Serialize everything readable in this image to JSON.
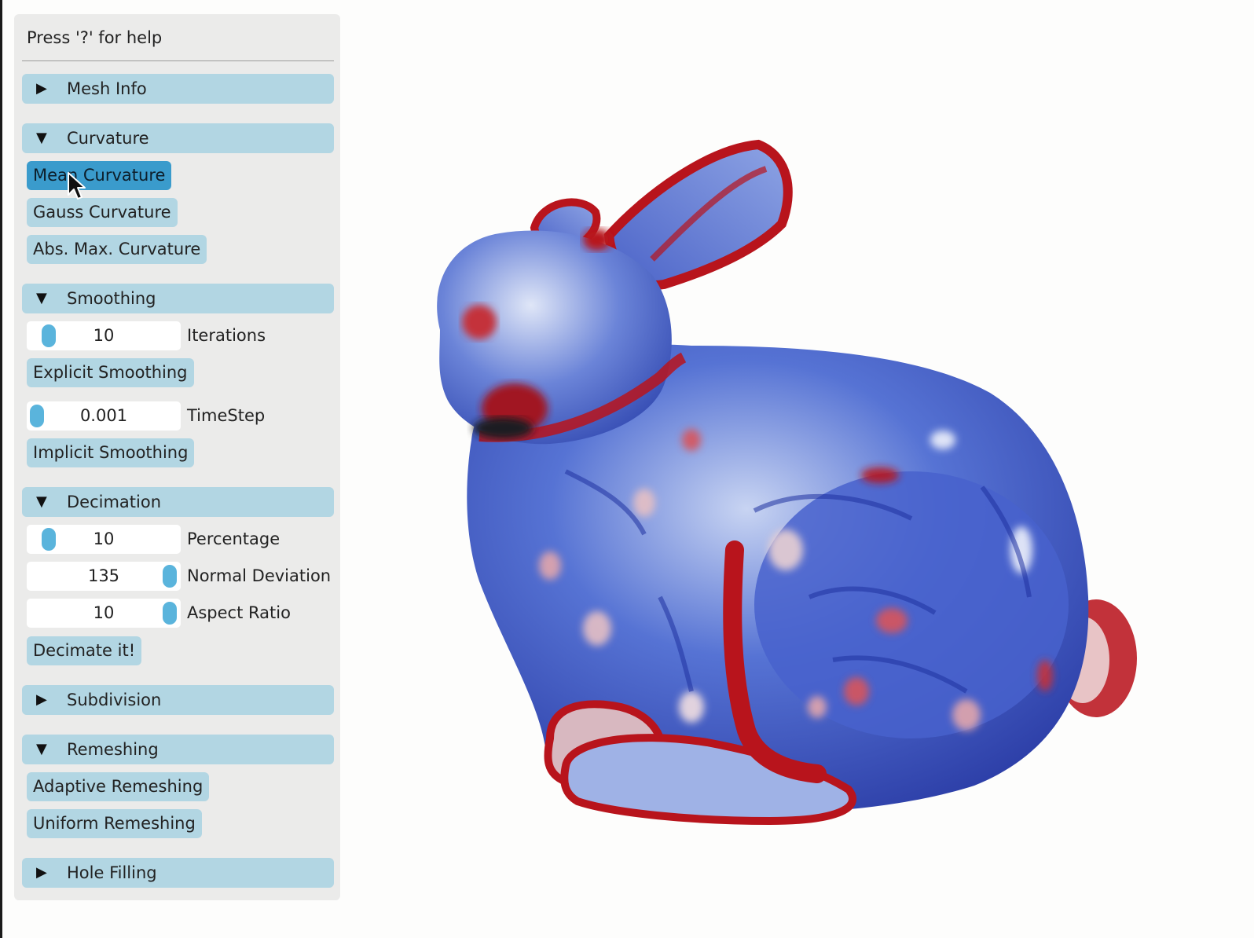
{
  "help_text": "Press '?' for help",
  "sections": {
    "mesh_info": {
      "label": "Mesh Info",
      "arrow": "▶"
    },
    "curvature": {
      "label": "Curvature",
      "arrow": "▼",
      "buttons": {
        "mean": "Mean Curvature",
        "gauss": "Gauss Curvature",
        "absmax": "Abs. Max. Curvature"
      }
    },
    "smoothing": {
      "label": "Smoothing",
      "arrow": "▼",
      "iterations": {
        "value": "10",
        "label": "Iterations"
      },
      "explicit": "Explicit Smoothing",
      "timestep": {
        "value": "0.001",
        "label": "TimeStep"
      },
      "implicit": "Implicit Smoothing"
    },
    "decimation": {
      "label": "Decimation",
      "arrow": "▼",
      "percentage": {
        "value": "10",
        "label": "Percentage"
      },
      "normal_deviation": {
        "value": "135",
        "label": "Normal Deviation"
      },
      "aspect_ratio": {
        "value": "10",
        "label": "Aspect Ratio"
      },
      "decimate": "Decimate it!"
    },
    "subdivision": {
      "label": "Subdivision",
      "arrow": "▶"
    },
    "remeshing": {
      "label": "Remeshing",
      "arrow": "▼",
      "adaptive": "Adaptive Remeshing",
      "uniform": "Uniform Remeshing"
    },
    "hole_filling": {
      "label": "Hole Filling",
      "arrow": "▶"
    }
  },
  "colors": {
    "accent": "#3a9bcc",
    "header": "#b2d6e3",
    "panel": "#ebebea",
    "mesh_blue": "#3a55c8",
    "mesh_red": "#b8141c"
  },
  "icons": {
    "cursor": "pointer-cursor-icon",
    "model": "stanford-bunny-mesh"
  }
}
